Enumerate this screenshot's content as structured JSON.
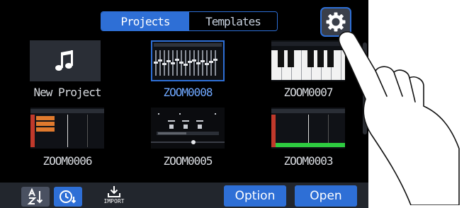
{
  "tabs": [
    {
      "label": "Projects",
      "active": true
    },
    {
      "label": "Templates",
      "active": false
    }
  ],
  "settings_icon": "gear-icon",
  "projects": [
    {
      "name": "New Project",
      "thumbnail": "music-note-icon",
      "selected": false
    },
    {
      "name": "ZOOM0008",
      "thumbnail": "mixer",
      "selected": true
    },
    {
      "name": "ZOOM0007",
      "thumbnail": "keyboard",
      "selected": false
    },
    {
      "name": "ZOOM0006",
      "thumbnail": "tracks-orange",
      "selected": false
    },
    {
      "name": "ZOOM0005",
      "thumbnail": "sampler",
      "selected": false
    },
    {
      "name": "ZOOM0003",
      "thumbnail": "tracks-green",
      "selected": false
    }
  ],
  "toolbar": {
    "sort_name_icon": "sort-alpha-icon",
    "sort_time_icon": "sort-clock-icon",
    "import_label": "IMPORT",
    "option_label": "Option",
    "open_label": "Open"
  },
  "colors": {
    "accent": "#2e6fd6",
    "selected_text": "#6fa8ff"
  }
}
